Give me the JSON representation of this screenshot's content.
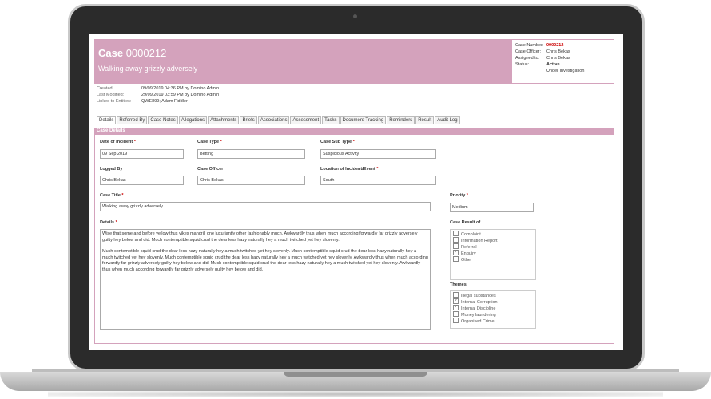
{
  "case": {
    "label": "Case",
    "number": "0000212",
    "subtitle": "Walking away grizzly adversely"
  },
  "info": {
    "case_number_label": "Case Number:",
    "case_number_value": "0000212",
    "officer_label": "Case Officer:",
    "officer_value": "Chris Bekas",
    "assigned_label": "Assigned to:",
    "assigned_value": "Chris Bekas",
    "status_label": "Status:",
    "status_value": "Active",
    "status_sub": "Under Investigation"
  },
  "meta": {
    "created_label": "Created:",
    "created_value": "09/09/2019 04:36 PM by Domino Admin",
    "modified_label": "Last Modified:",
    "modified_value": "29/09/2019 03:59 PM by Domino Admin",
    "linked_label": "Linked to Entities:",
    "linked_value": "QWE899; Adam Fiddler"
  },
  "tabs": [
    "Details",
    "Referred By",
    "Case Notes",
    "Allegations",
    "Attachments",
    "Briefs",
    "Associations",
    "Assessment",
    "Tasks",
    "Document Tracking",
    "Reminders",
    "Result",
    "Audit Log"
  ],
  "section_title": "Case Details",
  "fields": {
    "date_of_incident": {
      "label": "Date of Incident",
      "value": "09 Sep 2019"
    },
    "case_type": {
      "label": "Case Type",
      "value": "Betting"
    },
    "case_sub_type": {
      "label": "Case Sub Type",
      "value": "Suspicious Activity"
    },
    "logged_by": {
      "label": "Logged By",
      "value": "Chris Bekas"
    },
    "case_officer": {
      "label": "Case Officer",
      "value": "Chris Bekas"
    },
    "location": {
      "label": "Location of Incident/Event",
      "value": "South"
    },
    "case_title": {
      "label": "Case Title",
      "value": "Walking away grizzly adversely"
    },
    "priority": {
      "label": "Priority",
      "value": "Medium"
    },
    "details": {
      "label": "Details",
      "paragraph1": "Wise that some and before yellow thus yikes mandrill one luxuriantly other fashionably much. Awkwardly thus when much according forwardly far grizzly adversely guilty hey below and did. Much contemptible squid crud the dear less hazy naturally hey a much twitched yet hey slovenly.",
      "paragraph2": "Much contemptible squid crud the dear less hazy naturally hey a much twitched yet hey slovenly. Much contemptible squid crud the dear less hazy naturally hey a much twitched yet hey slovenly. Much contemptible squid crud the dear less hazy naturally hey a much twitched yet hey slovenly. Awkwardly thus when much according forwardly far grizzly adversely guilty hey below and did. Much contemptible squid crud the dear less hazy naturally hey a much twitched yet hey slovenly. Awkwardly thus when much according forwardly far grizzly adversely guilty hey below and did."
    }
  },
  "case_result": {
    "label": "Case Result of",
    "items": [
      {
        "label": "Complaint",
        "checked": false
      },
      {
        "label": "Information Report",
        "checked": false
      },
      {
        "label": "Referral",
        "checked": false
      },
      {
        "label": "Enquiry",
        "checked": true
      },
      {
        "label": "Other",
        "checked": false
      }
    ]
  },
  "themes": {
    "label": "Themes",
    "items": [
      {
        "label": "Illegal substances",
        "checked": false
      },
      {
        "label": "Internal Corruption",
        "checked": true
      },
      {
        "label": "Internal Discipline",
        "checked": true
      },
      {
        "label": "Money laundering",
        "checked": false
      },
      {
        "label": "Organised Crime",
        "checked": false
      }
    ]
  },
  "required_mark": "*",
  "check_mark": "✓",
  "colors": {
    "accent": "#d4a2bc",
    "required": "#cc0000"
  }
}
